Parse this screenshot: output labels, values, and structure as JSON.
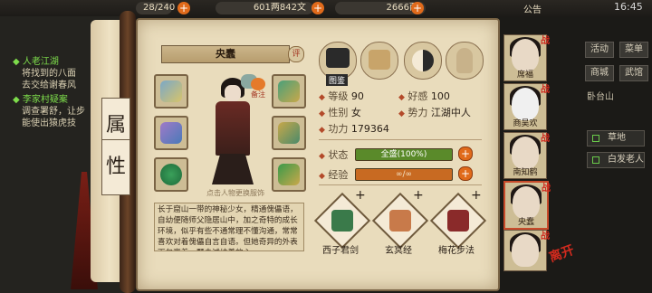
{
  "top": {
    "res1": "28/240",
    "res2": "601两842文",
    "res3": "2666两",
    "announce": "公告",
    "time": "16:45"
  },
  "tasks": [
    {
      "title": "人老江湖",
      "lines": [
        "将找到的八面",
        "去交给谢春风"
      ]
    },
    {
      "title": "李家村疑案",
      "lines": [
        "调查署舒，让步",
        "能使出猿虎技"
      ]
    }
  ],
  "scroll": {
    "title1": "属",
    "title2": "性"
  },
  "character": {
    "name": "央蠢",
    "ping": "评",
    "bianzhi": "备注",
    "hint": "点击人物更换服饰",
    "desc": "长于窟山一带的神秘少女，精通傀儡语，自幼便随师父隐居山中，加之奇特的成长环境，似乎有些不通常理不懂沟通，常常喜欢对着傀儡自言自语。但她奇异的外表下包裹着一颗赤诚纯善的心",
    "tabs": [
      "图鉴",
      "",
      "",
      ""
    ]
  },
  "stats": {
    "level_label": "等级",
    "level": "90",
    "favor_label": "好感",
    "favor": "100",
    "gender_label": "性别",
    "gender": "女",
    "faction_label": "势力",
    "faction": "江湖中人",
    "power_label": "功力",
    "power": "179364",
    "status_label": "状态",
    "status": "全盛(100%)",
    "status_fill": 1.0,
    "exp_label": "经验",
    "exp": "∞/∞",
    "exp_fill": 1.0
  },
  "skills": [
    "西子君剑",
    "玄冥经",
    "梅花步法"
  ],
  "portraits": [
    {
      "name": "席福",
      "badge": "战"
    },
    {
      "name": "商吴欢",
      "badge": "战"
    },
    {
      "name": "南知鹤",
      "badge": "战"
    },
    {
      "name": "央蠢",
      "badge": "战"
    },
    {
      "name": "",
      "badge": "战"
    }
  ],
  "right": {
    "btn1": "活动",
    "btn2": "菜单",
    "btn3": "商城",
    "btn4": "武馆",
    "place": "卧台山",
    "tag1": "草地",
    "tag2": "白发老人",
    "logo": "离开"
  }
}
